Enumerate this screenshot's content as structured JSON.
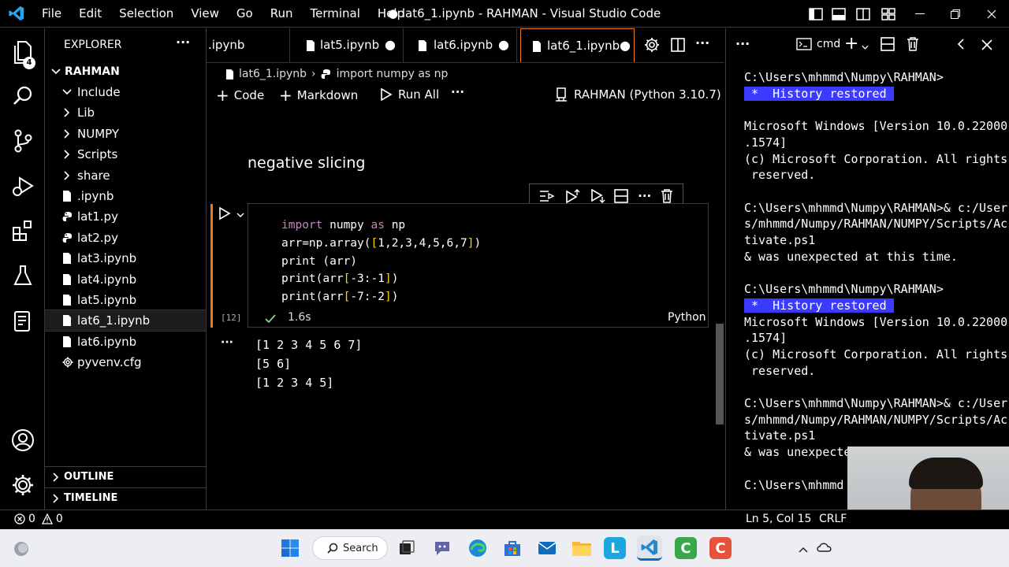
{
  "titlebar": {
    "menu": [
      "File",
      "Edit",
      "Selection",
      "View",
      "Go",
      "Run",
      "Terminal",
      "Help"
    ],
    "title": "● lat6_1.ipynb - RAHMAN - Visual Studio Code"
  },
  "activity": {
    "badge": "4"
  },
  "explorer": {
    "header": "EXPLORER",
    "more": "···",
    "root": "RAHMAN",
    "items": [
      {
        "label": "Include",
        "type": "folder-open"
      },
      {
        "label": "Lib",
        "type": "folder"
      },
      {
        "label": "NUMPY",
        "type": "folder"
      },
      {
        "label": "Scripts",
        "type": "folder"
      },
      {
        "label": "share",
        "type": "folder"
      },
      {
        "label": ".ipynb",
        "type": "notebook"
      },
      {
        "label": "lat1.py",
        "type": "python"
      },
      {
        "label": "lat2.py",
        "type": "python"
      },
      {
        "label": "lat3.ipynb",
        "type": "notebook"
      },
      {
        "label": "lat4.ipynb",
        "type": "notebook"
      },
      {
        "label": "lat5.ipynb",
        "type": "notebook"
      },
      {
        "label": "lat6_1.ipynb",
        "type": "notebook"
      },
      {
        "label": "lat6.ipynb",
        "type": "notebook"
      },
      {
        "label": "pyvenv.cfg",
        "type": "gear"
      }
    ],
    "outline": "OUTLINE",
    "timeline": "TIMELINE"
  },
  "tabs": [
    {
      "label": ".ipynb"
    },
    {
      "label": "lat5.ipynb"
    },
    {
      "label": "lat6.ipynb"
    },
    {
      "label": "lat6_1.ipynb"
    }
  ],
  "breadcrumb": {
    "file": "lat6_1.ipynb",
    "symbol": "import numpy as np"
  },
  "toolbar": {
    "code": "Code",
    "markdown": "Markdown",
    "run_all": "Run All",
    "more": "···",
    "kernel": "RAHMAN (Python 3.10.7)"
  },
  "notebook": {
    "markdown_cell": "negative slicing",
    "code_lines": [
      [
        {
          "t": "import",
          "c": "kw"
        },
        {
          "t": " numpy ",
          "c": "p"
        },
        {
          "t": "as",
          "c": "kw"
        },
        {
          "t": " np",
          "c": "p"
        }
      ],
      [
        {
          "t": "arr=np.array(",
          "c": "p"
        },
        {
          "t": "[",
          "c": "br"
        },
        {
          "t": "1,2,3,4,5,6,7",
          "c": "p"
        },
        {
          "t": "]",
          "c": "br"
        },
        {
          "t": ")",
          "c": "p"
        }
      ],
      [
        {
          "t": "print (arr)",
          "c": "p"
        }
      ],
      [
        {
          "t": "print(arr",
          "c": "p"
        },
        {
          "t": "[",
          "c": "br"
        },
        {
          "t": "-3:-1",
          "c": "p"
        },
        {
          "t": "]",
          "c": "br"
        },
        {
          "t": ")",
          "c": "p"
        }
      ],
      [
        {
          "t": "print(arr",
          "c": "p"
        },
        {
          "t": "[",
          "c": "br"
        },
        {
          "t": "-7:-2",
          "c": "p"
        },
        {
          "t": "]",
          "c": "br"
        },
        {
          "t": ")",
          "c": "p"
        }
      ]
    ],
    "exec_count": "[12]",
    "exec_time": "1.6s",
    "language": "Python",
    "output_more": "···",
    "output_lines": [
      "[1 2 3 4 5 6 7]",
      "[5 6]",
      "[1 2 3 4 5]"
    ]
  },
  "terminal": {
    "shell": "cmd",
    "lines": [
      {
        "text": "C:\\Users\\mhmmd\\Numpy\\RAHMAN>",
        "hl": false
      },
      {
        "text": " *  History restored ",
        "hl": true
      },
      {
        "text": "",
        "hl": false
      },
      {
        "text": "Microsoft Windows [Version 10.0.22000",
        "hl": false
      },
      {
        "text": ".1574]",
        "hl": false
      },
      {
        "text": "(c) Microsoft Corporation. All rights",
        "hl": false
      },
      {
        "text": " reserved.",
        "hl": false
      },
      {
        "text": "",
        "hl": false
      },
      {
        "text": "C:\\Users\\mhmmd\\Numpy\\RAHMAN>& c:/User",
        "hl": false
      },
      {
        "text": "s/mhmmd/Numpy/RAHMAN/NUMPY/Scripts/Ac",
        "hl": false
      },
      {
        "text": "tivate.ps1",
        "hl": false
      },
      {
        "text": "& was unexpected at this time.",
        "hl": false
      },
      {
        "text": "",
        "hl": false
      },
      {
        "text": "C:\\Users\\mhmmd\\Numpy\\RAHMAN>",
        "hl": false
      },
      {
        "text": " *  History restored ",
        "hl": true
      },
      {
        "text": "Microsoft Windows [Version 10.0.22000",
        "hl": false
      },
      {
        "text": ".1574]",
        "hl": false
      },
      {
        "text": "(c) Microsoft Corporation. All rights",
        "hl": false
      },
      {
        "text": " reserved.",
        "hl": false
      },
      {
        "text": "",
        "hl": false
      },
      {
        "text": "C:\\Users\\mhmmd\\Numpy\\RAHMAN>& c:/User",
        "hl": false
      },
      {
        "text": "s/mhmmd/Numpy/RAHMAN/NUMPY/Scripts/Ac",
        "hl": false
      },
      {
        "text": "tivate.ps1",
        "hl": false
      },
      {
        "text": "& was unexpecte",
        "hl": false
      },
      {
        "text": "",
        "hl": false
      },
      {
        "text": "C:\\Users\\mhmmd",
        "hl": false
      }
    ]
  },
  "status": {
    "errors": "0",
    "warnings": "0",
    "position": "Ln 5, Col 15",
    "eol": "CRLF"
  },
  "taskbar": {
    "search": "Search"
  },
  "colors": {
    "accent": "#e87c1e",
    "keyword": "#c586c0",
    "bracket": "#ffd700",
    "history": "#3b3bff",
    "success": "#89d185"
  }
}
